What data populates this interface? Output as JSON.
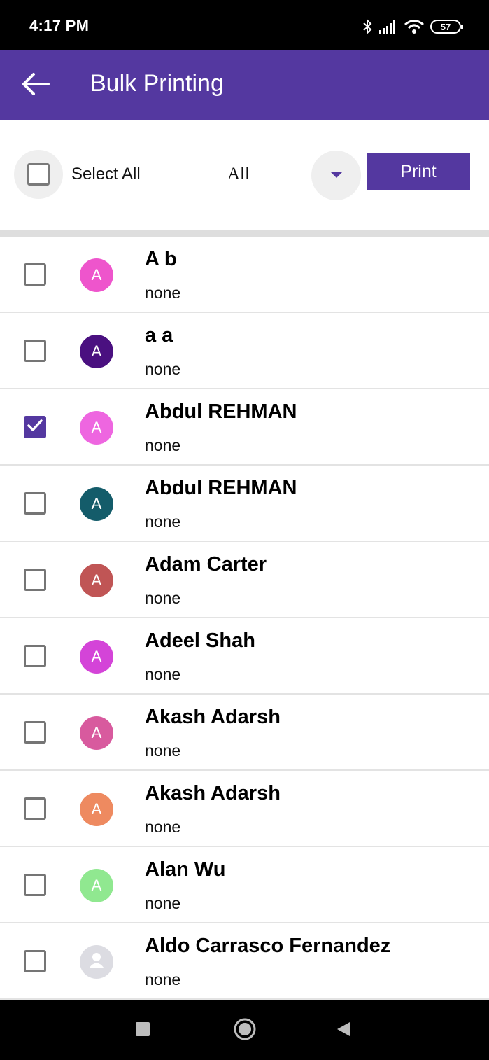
{
  "status_bar": {
    "time": "4:17 PM",
    "battery": "57",
    "icons": [
      "bluetooth-icon",
      "signal-icon",
      "wifi-icon",
      "battery-icon"
    ]
  },
  "app_bar": {
    "title": "Bulk Printing",
    "back_icon": "arrow-left-icon"
  },
  "toolbar": {
    "select_all_label": "Select All",
    "filter_value": "All",
    "print_label": "Print"
  },
  "colors": {
    "primary": "#5438a0"
  },
  "contacts": [
    {
      "name": "A b",
      "subtitle": "none",
      "initial": "A",
      "color": "#ee55cc",
      "checked": false
    },
    {
      "name": "a a",
      "subtitle": "none",
      "initial": "A",
      "color": "#4a1080",
      "checked": false
    },
    {
      "name": "Abdul REHMAN",
      "subtitle": "none",
      "initial": "A",
      "color": "#ee66e0",
      "checked": true
    },
    {
      "name": "Abdul REHMAN",
      "subtitle": "none",
      "initial": "A",
      "color": "#145c6a",
      "checked": false
    },
    {
      "name": "Adam Carter",
      "subtitle": "none",
      "initial": "A",
      "color": "#c05555",
      "checked": false
    },
    {
      "name": "Adeel Shah",
      "subtitle": "none",
      "initial": "A",
      "color": "#d444d8",
      "checked": false
    },
    {
      "name": "Akash Adarsh",
      "subtitle": "none",
      "initial": "A",
      "color": "#d85a9e",
      "checked": false
    },
    {
      "name": "Akash Adarsh",
      "subtitle": "none",
      "initial": "A",
      "color": "#ee8a60",
      "checked": false
    },
    {
      "name": "Alan Wu",
      "subtitle": "none",
      "initial": "A",
      "color": "#90e890",
      "checked": false
    },
    {
      "name": "Aldo Carrasco Fernandez",
      "subtitle": "none",
      "initial": "",
      "color": "#dcdce2",
      "checked": false
    }
  ],
  "nav_bar": {
    "icons": [
      "recents-square-icon",
      "home-circle-icon",
      "back-triangle-icon"
    ]
  }
}
